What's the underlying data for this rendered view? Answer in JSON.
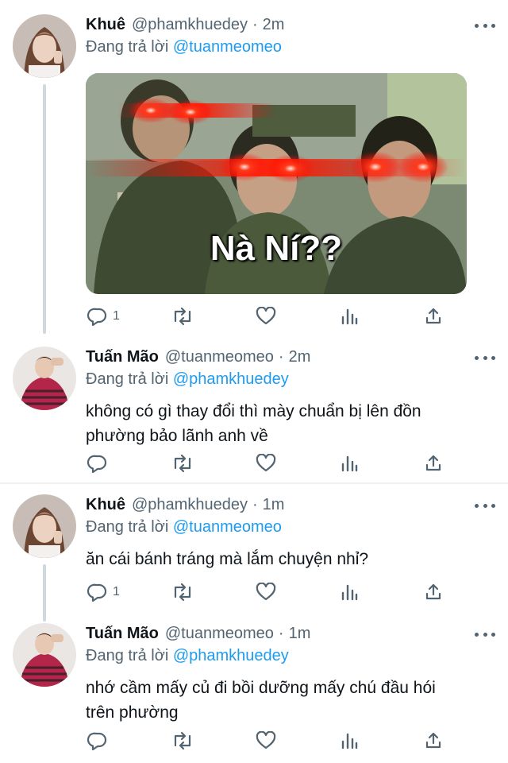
{
  "tweets": [
    {
      "name": "Khuê",
      "handle": "@phamkhuedey",
      "time": "2m",
      "replying_prefix": "Đang trả lời",
      "replying_to": "@tuanmeomeo",
      "media": {
        "caption": "Nà Ní??"
      },
      "reply_count": "1"
    },
    {
      "name": "Tuấn Mão",
      "handle": "@tuanmeomeo",
      "time": "2m",
      "replying_prefix": "Đang trả lời",
      "replying_to": "@phamkhuedey",
      "text_lines": [
        "không có gì thay đổi thì mày chuẩn bị lên đồn",
        "phường bảo lãnh anh về"
      ]
    },
    {
      "name": "Khuê",
      "handle": "@phamkhuedey",
      "time": "1m",
      "replying_prefix": "Đang trả lời",
      "replying_to": "@tuanmeomeo",
      "text_lines": [
        "ăn cái bánh tráng mà lắm chuyện nhỉ?"
      ],
      "reply_count": "1"
    },
    {
      "name": "Tuấn Mão",
      "handle": "@tuanmeomeo",
      "time": "1m",
      "replying_prefix": "Đang trả lời",
      "replying_to": "@phamkhuedey",
      "text_lines": [
        "nhớ cầm mấy củ đi bồi dưỡng mấy chú đầu hói",
        "trên phường"
      ]
    }
  ],
  "icons": {
    "reply": "reply-icon",
    "retweet": "retweet-icon",
    "like": "heart-icon",
    "analytics": "analytics-icon",
    "share": "share-icon",
    "more": "more-icon"
  },
  "colors": {
    "text": "#0f1419",
    "secondary": "#536471",
    "mention": "#1d9bf0",
    "thread_line": "#cfd9de",
    "divider": "#eff3f4"
  }
}
